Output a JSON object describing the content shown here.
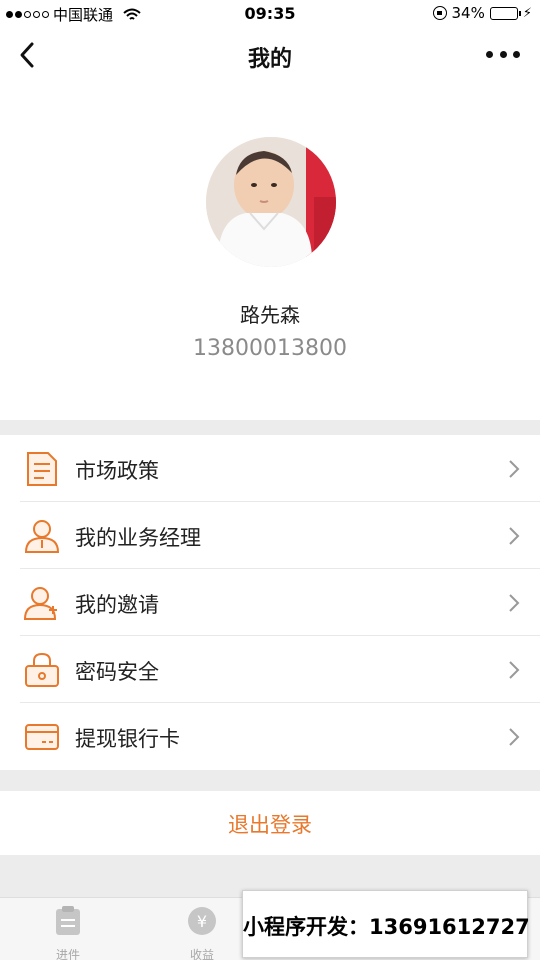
{
  "status_bar": {
    "carrier": "中国联通",
    "time": "09:35",
    "battery_text": "34%",
    "battery_level": 0.34,
    "signal_bars_filled": 2,
    "signal_bars_total": 5
  },
  "nav": {
    "title": "我的",
    "back_icon": "chevron-left-icon",
    "more_icon": "more-dots-icon"
  },
  "profile": {
    "name": "路先森",
    "phone": "13800013800"
  },
  "menu": {
    "items": [
      {
        "label": "市场政策",
        "icon": "document-icon"
      },
      {
        "label": "我的业务经理",
        "icon": "manager-icon"
      },
      {
        "label": "我的邀请",
        "icon": "invite-user-icon"
      },
      {
        "label": "密码安全",
        "icon": "lock-icon"
      },
      {
        "label": "提现银行卡",
        "icon": "bank-card-icon"
      }
    ]
  },
  "logout": {
    "label": "退出登录"
  },
  "tab_bar": {
    "tabs": [
      {
        "label": "进件",
        "icon": "clipboard-icon"
      },
      {
        "label": "收益",
        "icon": "yen-icon"
      }
    ]
  },
  "promo": {
    "text": "小程序开发：13691612727"
  },
  "colors": {
    "accent": "#e8782c",
    "background": "#ececec",
    "battery": "#5ad04a"
  }
}
